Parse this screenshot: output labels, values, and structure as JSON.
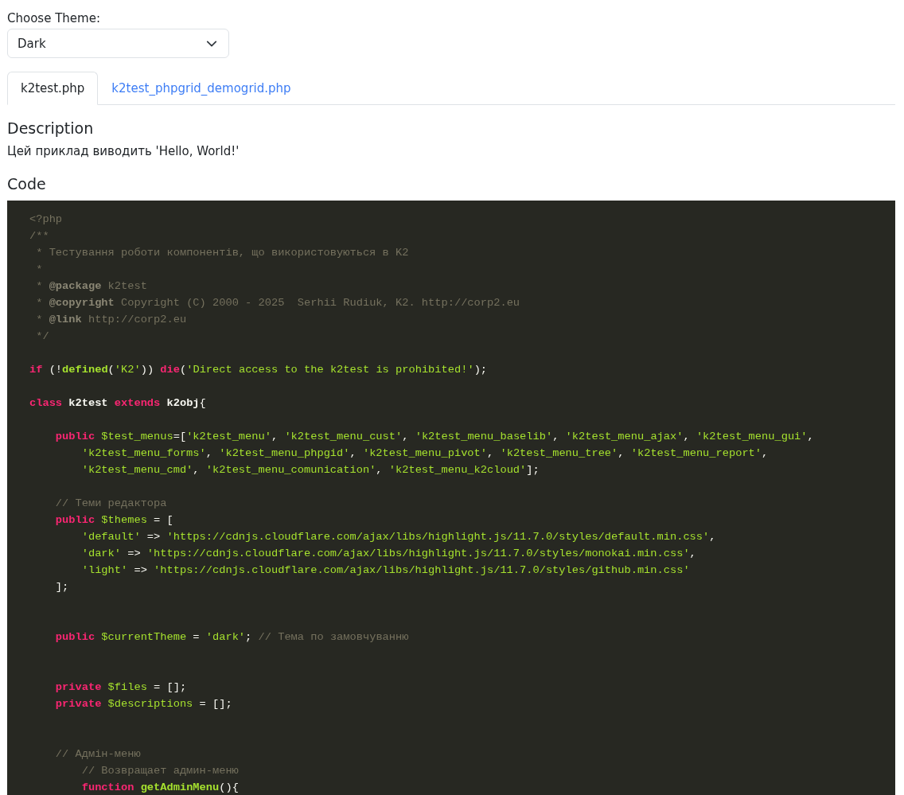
{
  "theme_select": {
    "label": "Choose Theme:",
    "value": "Dark"
  },
  "tabs": [
    {
      "label": "k2test.php",
      "selected": true
    },
    {
      "label": "k2test_phpgrid_demogrid.php",
      "selected": false
    }
  ],
  "description": {
    "heading": "Description",
    "text": "Цей приклад виводить 'Hello, World!'"
  },
  "code": {
    "heading": "Code",
    "lines": [
      {
        "kind": "top",
        "tokens": [
          {
            "kind": "comment",
            "text": "<?php"
          }
        ]
      },
      {
        "kind": "top",
        "tokens": [
          {
            "kind": "comment",
            "text": "/**"
          }
        ]
      },
      {
        "kind": "top",
        "tokens": [
          {
            "kind": "comment",
            "text": " * Тестування роботи компонентів, що використовуються в K2"
          }
        ]
      },
      {
        "kind": "top",
        "tokens": [
          {
            "kind": "comment",
            "text": " *"
          }
        ]
      },
      {
        "kind": "top",
        "tokens": [
          {
            "kind": "comment",
            "text": " * "
          },
          {
            "kind": "doctag",
            "text": "@package"
          },
          {
            "kind": "comment",
            "text": " k2test"
          }
        ]
      },
      {
        "kind": "top",
        "tokens": [
          {
            "kind": "comment",
            "text": " * "
          },
          {
            "kind": "doctag",
            "text": "@copyright"
          },
          {
            "kind": "comment",
            "text": " Copyright (C) 2000 - 2025  Serhii Rudiuk, K2. http://corp2.eu"
          }
        ]
      },
      {
        "kind": "top",
        "tokens": [
          {
            "kind": "comment",
            "text": " * "
          },
          {
            "kind": "doctag",
            "text": "@link"
          },
          {
            "kind": "comment",
            "text": " http://corp2.eu"
          }
        ]
      },
      {
        "kind": "top",
        "tokens": [
          {
            "kind": "comment",
            "text": " */"
          }
        ]
      },
      {
        "kind": "blank"
      },
      {
        "kind": "top",
        "tokens": [
          {
            "kind": "keyword",
            "text": "if"
          },
          {
            "kind": "plain",
            "text": " (!"
          },
          {
            "kind": "func",
            "text": "defined"
          },
          {
            "kind": "plain",
            "text": "("
          },
          {
            "kind": "string",
            "text": "'K2'"
          },
          {
            "kind": "plain",
            "text": ")) "
          },
          {
            "kind": "keyword",
            "text": "die"
          },
          {
            "kind": "plain",
            "text": "("
          },
          {
            "kind": "string",
            "text": "'Direct access to the k2test is prohibited!'"
          },
          {
            "kind": "plain",
            "text": ");"
          }
        ]
      },
      {
        "kind": "blank"
      },
      {
        "kind": "top",
        "tokens": [
          {
            "kind": "keyword",
            "text": "class"
          },
          {
            "kind": "title",
            "text": " k2test"
          },
          {
            "kind": "keyword",
            "text": " extends"
          },
          {
            "kind": "title",
            "text": " k2obj"
          },
          {
            "kind": "plain",
            "text": "{"
          }
        ]
      },
      {
        "kind": "blank"
      },
      {
        "kind": "inner",
        "tokens": [
          {
            "kind": "keyword",
            "text": "public"
          },
          {
            "kind": "variable",
            "text": " $test_menus"
          },
          {
            "kind": "plain",
            "text": "=["
          },
          {
            "kind": "string",
            "text": "'k2test_menu'"
          },
          {
            "kind": "plain",
            "text": ", "
          },
          {
            "kind": "string",
            "text": "'k2test_menu_cust'"
          },
          {
            "kind": "plain",
            "text": ", "
          },
          {
            "kind": "string",
            "text": "'k2test_menu_baselib'"
          },
          {
            "kind": "plain",
            "text": ", "
          },
          {
            "kind": "string",
            "text": "'k2test_menu_ajax'"
          },
          {
            "kind": "plain",
            "text": ", "
          },
          {
            "kind": "string",
            "text": "'k2test_menu_gui'"
          },
          {
            "kind": "plain",
            "text": ","
          }
        ]
      },
      {
        "kind": "deep",
        "tokens": [
          {
            "kind": "string",
            "text": "'k2test_menu_forms'"
          },
          {
            "kind": "plain",
            "text": ", "
          },
          {
            "kind": "string",
            "text": "'k2test_menu_phpgid'"
          },
          {
            "kind": "plain",
            "text": ", "
          },
          {
            "kind": "string",
            "text": "'k2test_menu_pivot'"
          },
          {
            "kind": "plain",
            "text": ", "
          },
          {
            "kind": "string",
            "text": "'k2test_menu_tree'"
          },
          {
            "kind": "plain",
            "text": ", "
          },
          {
            "kind": "string",
            "text": "'k2test_menu_report'"
          },
          {
            "kind": "plain",
            "text": ","
          }
        ]
      },
      {
        "kind": "deep",
        "tokens": [
          {
            "kind": "string",
            "text": "'k2test_menu_cmd'"
          },
          {
            "kind": "plain",
            "text": ", "
          },
          {
            "kind": "string",
            "text": "'k2test_menu_comunication'"
          },
          {
            "kind": "plain",
            "text": ", "
          },
          {
            "kind": "string",
            "text": "'k2test_menu_k2cloud'"
          },
          {
            "kind": "plain",
            "text": "];"
          }
        ]
      },
      {
        "kind": "blank"
      },
      {
        "kind": "inner",
        "tokens": [
          {
            "kind": "comment",
            "text": "// Теми редактора"
          }
        ]
      },
      {
        "kind": "inner",
        "tokens": [
          {
            "kind": "keyword",
            "text": "public"
          },
          {
            "kind": "variable",
            "text": " $themes"
          },
          {
            "kind": "plain",
            "text": " = ["
          }
        ]
      },
      {
        "kind": "deep",
        "tokens": [
          {
            "kind": "string",
            "text": "'default'"
          },
          {
            "kind": "plain",
            "text": " => "
          },
          {
            "kind": "string",
            "text": "'https://cdnjs.cloudflare.com/ajax/libs/highlight.js/11.7.0/styles/default.min.css'"
          },
          {
            "kind": "plain",
            "text": ","
          }
        ]
      },
      {
        "kind": "deep",
        "tokens": [
          {
            "kind": "string",
            "text": "'dark'"
          },
          {
            "kind": "plain",
            "text": " => "
          },
          {
            "kind": "string",
            "text": "'https://cdnjs.cloudflare.com/ajax/libs/highlight.js/11.7.0/styles/monokai.min.css'"
          },
          {
            "kind": "plain",
            "text": ","
          }
        ]
      },
      {
        "kind": "deep",
        "tokens": [
          {
            "kind": "string",
            "text": "'light'"
          },
          {
            "kind": "plain",
            "text": " => "
          },
          {
            "kind": "string",
            "text": "'https://cdnjs.cloudflare.com/ajax/libs/highlight.js/11.7.0/styles/github.min.css'"
          }
        ]
      },
      {
        "kind": "inner",
        "tokens": [
          {
            "kind": "plain",
            "text": "];"
          }
        ]
      },
      {
        "kind": "blank"
      },
      {
        "kind": "blank"
      },
      {
        "kind": "inner",
        "tokens": [
          {
            "kind": "keyword",
            "text": "public"
          },
          {
            "kind": "variable",
            "text": " $currentTheme"
          },
          {
            "kind": "plain",
            "text": " = "
          },
          {
            "kind": "string",
            "text": "'dark'"
          },
          {
            "kind": "plain",
            "text": "; "
          },
          {
            "kind": "comment",
            "text": "// Тема по замовчуванню"
          }
        ]
      },
      {
        "kind": "blank"
      },
      {
        "kind": "blank"
      },
      {
        "kind": "inner",
        "tokens": [
          {
            "kind": "keyword",
            "text": "private"
          },
          {
            "kind": "variable",
            "text": " $files"
          },
          {
            "kind": "plain",
            "text": " = [];"
          }
        ]
      },
      {
        "kind": "inner",
        "tokens": [
          {
            "kind": "keyword",
            "text": "private"
          },
          {
            "kind": "variable",
            "text": " $descriptions"
          },
          {
            "kind": "plain",
            "text": " = [];"
          }
        ]
      },
      {
        "kind": "blank"
      },
      {
        "kind": "blank"
      },
      {
        "kind": "inner",
        "tokens": [
          {
            "kind": "comment",
            "text": "// Адмін-меню"
          }
        ]
      },
      {
        "kind": "deep",
        "tokens": [
          {
            "kind": "comment",
            "text": "// Возвращает админ-меню"
          }
        ]
      },
      {
        "kind": "deep",
        "tokens": [
          {
            "kind": "keyword",
            "text": "function"
          },
          {
            "kind": "func",
            "text": " getAdminMenu"
          },
          {
            "kind": "plain",
            "text": "(){"
          }
        ]
      }
    ]
  }
}
